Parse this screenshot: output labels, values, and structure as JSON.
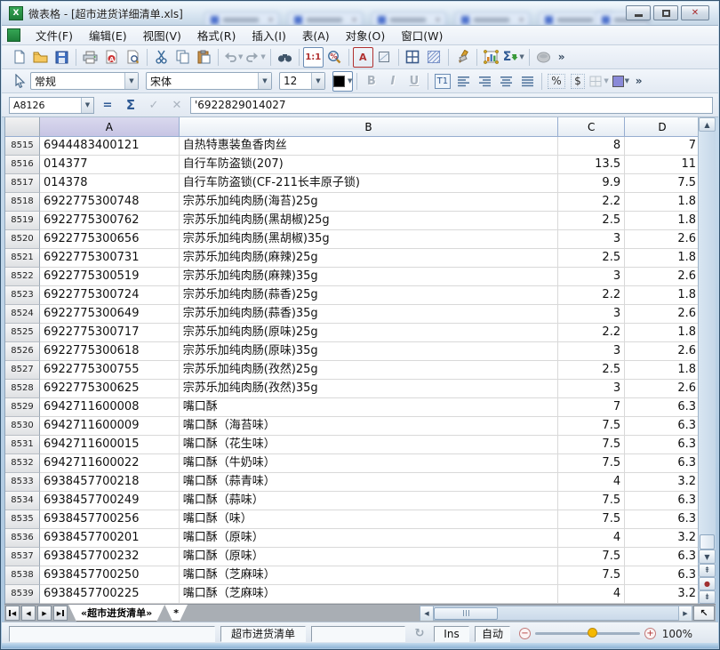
{
  "window": {
    "title": "微表格 - [超市进货详细清单.xls]"
  },
  "menu": {
    "items": [
      "文件(F)",
      "编辑(E)",
      "视图(V)",
      "格式(R)",
      "插入(I)",
      "表(A)",
      "对象(O)",
      "窗口(W)"
    ]
  },
  "toolbar1": {
    "zoom_1to1": "1:1",
    "font_color": "A",
    "autosum": "Σ",
    "overflow": "»"
  },
  "toolbar2": {
    "style_value": "常规",
    "font_value": "宋体",
    "size_value": "12",
    "bold": "B",
    "italic": "I",
    "underline": "U",
    "orientation": "T1",
    "percent": "%",
    "currency": "$",
    "overflow": "»"
  },
  "formula_bar": {
    "cell_ref": "A8126",
    "equals": "=",
    "sigma": "Σ",
    "confirm": "✓",
    "cancel": "✕",
    "content": "'6922829014027"
  },
  "grid": {
    "columns": [
      "A",
      "B",
      "C",
      "D"
    ],
    "rows": [
      {
        "n": "8515",
        "a": "6944483400121",
        "b": "自热特惠装鱼香肉丝",
        "c": "8",
        "d": "7"
      },
      {
        "n": "8516",
        "a": "014377",
        "b": "自行车防盗锁(207)",
        "c": "13.5",
        "d": "11"
      },
      {
        "n": "8517",
        "a": "014378",
        "b": "自行车防盗锁(CF-211长丰原子锁)",
        "c": "9.9",
        "d": "7.5"
      },
      {
        "n": "8518",
        "a": "6922775300748",
        "b": "宗苏乐加纯肉肠(海苔)25g",
        "c": "2.2",
        "d": "1.8"
      },
      {
        "n": "8519",
        "a": "6922775300762",
        "b": "宗苏乐加纯肉肠(黑胡椒)25g",
        "c": "2.5",
        "d": "1.8"
      },
      {
        "n": "8520",
        "a": "6922775300656",
        "b": "宗苏乐加纯肉肠(黑胡椒)35g",
        "c": "3",
        "d": "2.6"
      },
      {
        "n": "8521",
        "a": "6922775300731",
        "b": "宗苏乐加纯肉肠(麻辣)25g",
        "c": "2.5",
        "d": "1.8"
      },
      {
        "n": "8522",
        "a": "6922775300519",
        "b": "宗苏乐加纯肉肠(麻辣)35g",
        "c": "3",
        "d": "2.6"
      },
      {
        "n": "8523",
        "a": "6922775300724",
        "b": "宗苏乐加纯肉肠(蒜香)25g",
        "c": "2.2",
        "d": "1.8"
      },
      {
        "n": "8524",
        "a": "6922775300649",
        "b": "宗苏乐加纯肉肠(蒜香)35g",
        "c": "3",
        "d": "2.6"
      },
      {
        "n": "8525",
        "a": "6922775300717",
        "b": "宗苏乐加纯肉肠(原味)25g",
        "c": "2.2",
        "d": "1.8"
      },
      {
        "n": "8526",
        "a": "6922775300618",
        "b": "宗苏乐加纯肉肠(原味)35g",
        "c": "3",
        "d": "2.6"
      },
      {
        "n": "8527",
        "a": "6922775300755",
        "b": "宗苏乐加纯肉肠(孜然)25g",
        "c": "2.5",
        "d": "1.8"
      },
      {
        "n": "8528",
        "a": "6922775300625",
        "b": "宗苏乐加纯肉肠(孜然)35g",
        "c": "3",
        "d": "2.6"
      },
      {
        "n": "8529",
        "a": "6942711600008",
        "b": "嘴口酥",
        "c": "7",
        "d": "6.3"
      },
      {
        "n": "8530",
        "a": "6942711600009",
        "b": "嘴口酥（海苔味）",
        "c": "7.5",
        "d": "6.3"
      },
      {
        "n": "8531",
        "a": "6942711600015",
        "b": "嘴口酥（花生味）",
        "c": "7.5",
        "d": "6.3"
      },
      {
        "n": "8532",
        "a": "6942711600022",
        "b": "嘴口酥（牛奶味）",
        "c": "7.5",
        "d": "6.3"
      },
      {
        "n": "8533",
        "a": "6938457700218",
        "b": "嘴口酥（蒜青味）",
        "c": "4",
        "d": "3.2"
      },
      {
        "n": "8534",
        "a": "6938457700249",
        "b": "嘴口酥（蒜味）",
        "c": "7.5",
        "d": "6.3"
      },
      {
        "n": "8535",
        "a": "6938457700256",
        "b": "嘴口酥（味）",
        "c": "7.5",
        "d": "6.3"
      },
      {
        "n": "8536",
        "a": "6938457700201",
        "b": "嘴口酥（原味）",
        "c": "4",
        "d": "3.2"
      },
      {
        "n": "8537",
        "a": "6938457700232",
        "b": "嘴口酥（原味）",
        "c": "7.5",
        "d": "6.3"
      },
      {
        "n": "8538",
        "a": "6938457700250",
        "b": "嘴口酥（芝麻味）",
        "c": "7.5",
        "d": "6.3"
      },
      {
        "n": "8539",
        "a": "6938457700225",
        "b": "嘴口酥（芝麻味）",
        "c": "4",
        "d": "3.2"
      }
    ]
  },
  "sheet_bar": {
    "active_tab": "«超市进货清单»",
    "second_tab": "*"
  },
  "status_bar": {
    "sheet_name": "超市进货清单",
    "insert_mode": "Ins",
    "calc_mode": "自动",
    "zoom_level": "100%"
  },
  "colors": {
    "close_glyph": "#a82a2c",
    "column_a_highlight": "#c7c5e4",
    "fill_swatch": "#8a8ad8",
    "font_color_swatch": "#000000",
    "zoom_thumb": "#f5b800",
    "pdf_red": "#cc3333"
  }
}
